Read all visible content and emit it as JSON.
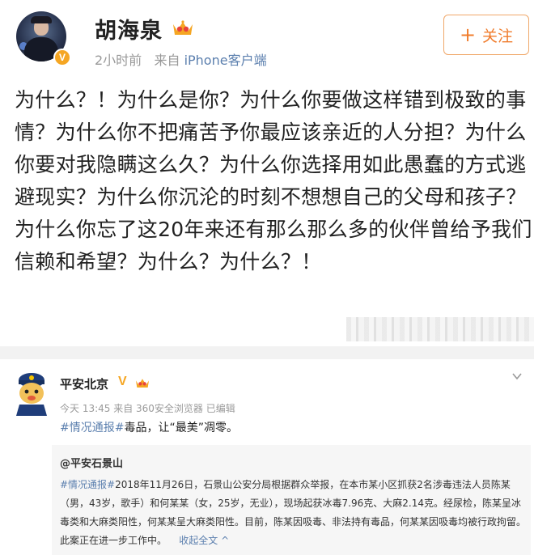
{
  "post1": {
    "username": "胡海泉",
    "time": "2小时前",
    "source_prefix": "来自",
    "source": "iPhone客户端",
    "follow_label": "关注",
    "follow_icon": "plus-icon",
    "content": "为什么？！为什么是你？为什么你要做这样错到极致的事情？为什么你不把痛苦予你最应该亲近的人分担？为什么你要对我隐瞒这么久？为什么你选择用如此愚蠢的方式逃避现实？为什么你沉沦的时刻不想想自己的父母和孩子？为什么你忘了这20年来还有那么那么多的伙伴曾给予我们信赖和希望？为什么？为什么？！"
  },
  "post2": {
    "username": "平安北京",
    "verified_mark": "V",
    "meta": "今天 13:45 来自 360安全浏览器   已编辑",
    "tag": "#情况通报#",
    "content_rest": "毒品，让“最美”凋零。",
    "repost": {
      "username": "@平安石景山",
      "tag": "#情况通报#",
      "text": "2018年11月26日，石景山公安分局根据群众举报，在本市某小区抓获2名涉毒违法人员陈某（男，43岁，歌手）和何某某（女，25岁，无业），现场起获冰毒7.96克、大麻2.14克。经尿检，陈某呈冰毒类和大麻类阳性，何某某呈大麻类阳性。目前，陈某因吸毒、非法持有毒品，何某某因吸毒均被行政拘留。此案正在进一步工作中。",
      "collapse_label": "收起全文 ^"
    }
  },
  "colors": {
    "link": "#5b7fae",
    "follow_orange": "#f07c2c",
    "badge_gold": "#f5a623",
    "meta_gray": "#999999"
  }
}
